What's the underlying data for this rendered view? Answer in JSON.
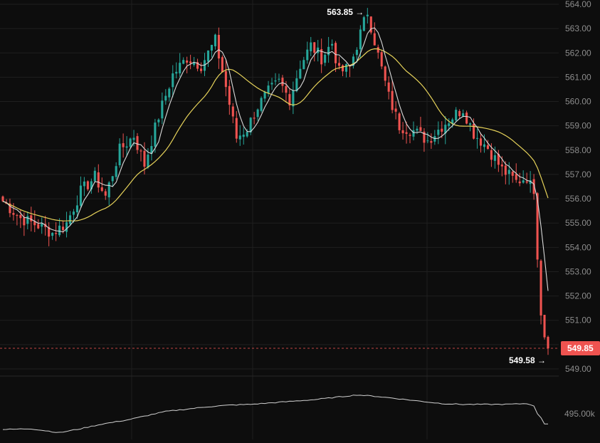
{
  "chart_data": {
    "type": "candlestick",
    "y_axis": {
      "min": 548.7,
      "max": 564.1,
      "ticks": [
        "549.00",
        "550.00",
        "551.00",
        "552.00",
        "553.00",
        "554.00",
        "555.00",
        "556.00",
        "557.00",
        "558.00",
        "559.00",
        "560.00",
        "561.00",
        "562.00",
        "563.00",
        "564.00"
      ]
    },
    "grid": true,
    "colors": {
      "background": "#0d0d0d",
      "grid": "#1f1f1f",
      "up": "#26a69a",
      "down": "#ef5350",
      "ma_fast": "#d9d9d9",
      "ma_slow": "#e6d25a",
      "volume_line": "#d0d0d0",
      "price_line": "#ef5350",
      "badge": "#ef5350"
    },
    "anchors": [
      [
        0,
        555.9
      ],
      [
        5,
        555.2
      ],
      [
        10,
        554.9
      ],
      [
        14,
        554.6
      ],
      [
        18,
        555.0
      ],
      [
        22,
        556.3
      ],
      [
        26,
        556.9
      ],
      [
        29,
        556.1
      ],
      [
        33,
        558.0
      ],
      [
        37,
        558.6
      ],
      [
        40,
        557.4
      ],
      [
        44,
        559.4
      ],
      [
        48,
        561.1
      ],
      [
        52,
        561.8
      ],
      [
        56,
        561.5
      ],
      [
        60,
        562.5
      ],
      [
        63,
        560.6
      ],
      [
        66,
        558.5
      ],
      [
        69,
        558.9
      ],
      [
        72,
        559.8
      ],
      [
        75,
        560.4
      ],
      [
        78,
        560.8
      ],
      [
        81,
        560.1
      ],
      [
        84,
        561.5
      ],
      [
        87,
        562.3
      ],
      [
        90,
        561.8
      ],
      [
        93,
        562.4
      ],
      [
        95,
        561.2
      ],
      [
        98,
        561.4
      ],
      [
        101,
        562.8
      ],
      [
        103,
        563.7
      ],
      [
        106,
        561.9
      ],
      [
        109,
        560.2
      ],
      [
        112,
        559.0
      ],
      [
        116,
        558.8
      ],
      [
        120,
        558.4
      ],
      [
        124,
        559.0
      ],
      [
        128,
        559.5
      ],
      [
        130,
        559.7
      ],
      [
        133,
        558.7
      ],
      [
        137,
        558.1
      ],
      [
        141,
        557.2
      ],
      [
        145,
        556.7
      ],
      [
        148,
        556.9
      ],
      [
        150,
        556.2
      ],
      [
        151,
        553.5
      ],
      [
        152,
        551.2
      ],
      [
        153,
        550.3
      ],
      [
        154,
        549.85
      ]
    ],
    "volume_anchors": [
      [
        0,
        493.9
      ],
      [
        8,
        494.0
      ],
      [
        16,
        493.5
      ],
      [
        22,
        494.0
      ],
      [
        28,
        494.6
      ],
      [
        35,
        495.1
      ],
      [
        41,
        495.7
      ],
      [
        46,
        496.2
      ],
      [
        52,
        496.5
      ],
      [
        58,
        496.8
      ],
      [
        64,
        497.0
      ],
      [
        70,
        497.1
      ],
      [
        76,
        497.3
      ],
      [
        82,
        497.5
      ],
      [
        88,
        497.7
      ],
      [
        94,
        498.0
      ],
      [
        100,
        498.3
      ],
      [
        106,
        498.1
      ],
      [
        112,
        497.8
      ],
      [
        118,
        497.5
      ],
      [
        124,
        497.2
      ],
      [
        130,
        497.1
      ],
      [
        136,
        497.1
      ],
      [
        142,
        497.1
      ],
      [
        148,
        497.2
      ],
      [
        150,
        496.9
      ],
      [
        151,
        495.9
      ],
      [
        152,
        495.4
      ],
      [
        153,
        494.6
      ],
      [
        154,
        494.6
      ]
    ],
    "volume_axis_label": "495.00k",
    "last_price": "549.85",
    "high_annotation": {
      "label": "563.85 →",
      "value": 563.85
    },
    "low_annotation": {
      "label": "549.58 →",
      "value": 549.58
    }
  }
}
